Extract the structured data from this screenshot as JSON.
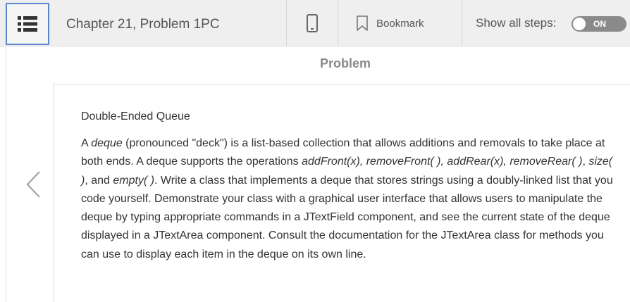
{
  "header": {
    "chapter_title": "Chapter 21, Problem 1PC",
    "bookmark_label": "Bookmark",
    "show_steps_label": "Show all steps:",
    "toggle_state": "ON"
  },
  "section": {
    "heading": "Problem"
  },
  "problem": {
    "title": "Double-Ended Queue",
    "body": {
      "t1": "A ",
      "deque": "deque",
      "t2": " (pronounced \"deck\") is a list-based collection that allows additions and removals to take place at both ends. A deque supports the operations ",
      "ops": "addFront(x), removeFront( ), addRear(x), removeRear( )",
      "t3": ", ",
      "size": "size( )",
      "t4": ", and ",
      "empty": "empty( )",
      "t5": ". Write a class that implements a deque that stores strings using a doubly-linked list that you code yourself. Demonstrate your class with a graphical user interface that allows users to manipulate the deque by typing appropriate commands in a JTextField component, and see the current state of the deque displayed in a JTextArea component. Consult the documentation for the JTextArea class for methods you can use to display each item in the deque on its own line."
    }
  },
  "icons": {
    "menu": "list-menu-icon",
    "mobile": "mobile-phone-icon",
    "bookmark": "bookmark-icon",
    "previous": "chevron-left-icon"
  },
  "colors": {
    "menu_border": "#5b86c9",
    "toggle_bg": "#8a8a8a",
    "topbar_bg": "#efefef"
  }
}
